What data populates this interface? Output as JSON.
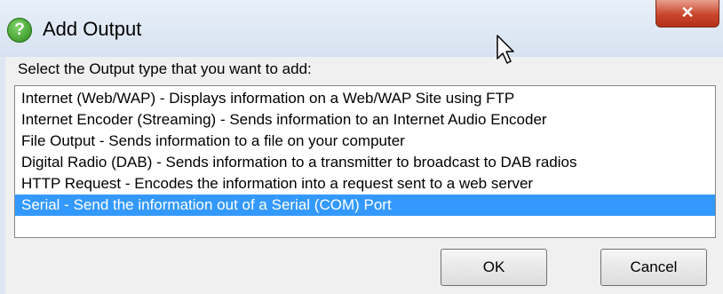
{
  "window": {
    "title": "Add Output",
    "help_icon_glyph": "?",
    "close_glyph": "✕"
  },
  "prompt": "Select the Output type that you want to add:",
  "list": {
    "items": [
      "Internet (Web/WAP) - Displays information on a Web/WAP Site using FTP",
      "Internet Encoder (Streaming) - Sends information to an Internet Audio Encoder",
      "File Output - Sends information to a file on your computer",
      "Digital Radio (DAB) - Sends information to a transmitter to broadcast to DAB radios",
      "HTTP Request - Encodes the information into a request sent to a web server",
      "Serial - Send the information out of a Serial (COM) Port"
    ],
    "selected_index": 5
  },
  "buttons": {
    "ok": "OK",
    "cancel": "Cancel"
  },
  "colors": {
    "selection": "#3399ff",
    "close_button": "#c9452b"
  }
}
